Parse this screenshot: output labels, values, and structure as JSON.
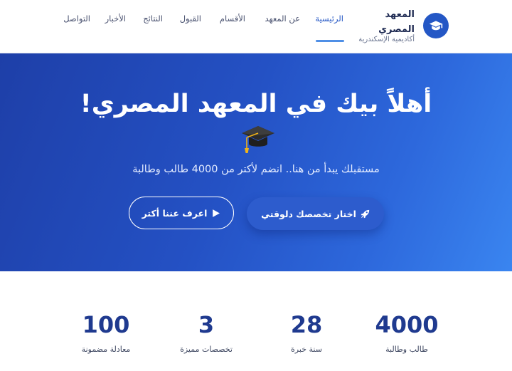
{
  "header": {
    "brand_name": "المعهد المصري",
    "brand_tagline": "أكاديمية الإسكندرية",
    "logo_icon": "graduation-cap-icon",
    "nav": [
      {
        "label": "الرئيسية",
        "active": true
      },
      {
        "label": "عن المعهد"
      },
      {
        "label": "الأقسام"
      },
      {
        "label": "القبول"
      },
      {
        "label": "النتائج"
      },
      {
        "label": "الأخبار"
      },
      {
        "label": "التواصل"
      }
    ]
  },
  "hero": {
    "title": "أهلاً بيك في المعهد المصري!",
    "title_icon": "graduation-cap-emoji",
    "subtitle": "مستقبلك يبدأ من هنا.. انضم لأكتر من 4000 طالب وطالبة",
    "primary_button": {
      "label": "اختار تخصصك دلوقتي",
      "icon": "rocket-icon"
    },
    "secondary_button": {
      "label": "اعرف عننا أكتر",
      "icon": "play-icon"
    }
  },
  "stats": [
    {
      "value": "4000",
      "label": "طالب وطالبة"
    },
    {
      "value": "28",
      "label": "سنة خبرة"
    },
    {
      "value": "3",
      "label": "تخصصات مميزة"
    },
    {
      "value": "100",
      "label": "معادلة مضمونة"
    }
  ],
  "colors": {
    "brand_blue": "#2457c5",
    "hero_gradient_start": "#1e3fa8",
    "hero_gradient_end": "#3a85f0",
    "stat_number": "#1f3a8f",
    "text_dark": "#1e2a52"
  }
}
